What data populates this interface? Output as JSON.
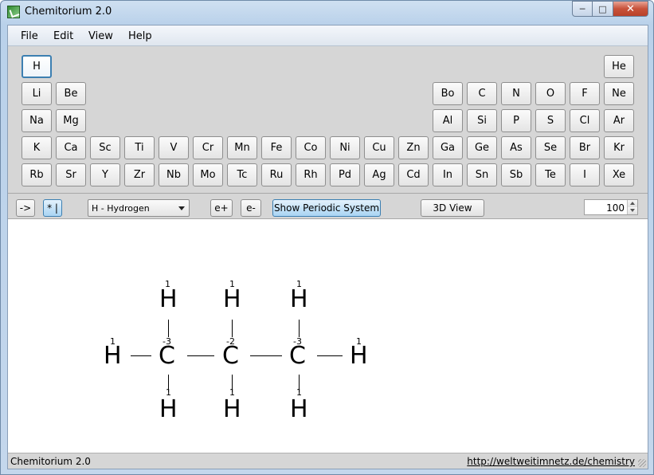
{
  "window": {
    "title": "Chemitorium 2.0"
  },
  "menu": {
    "file": "File",
    "edit": "Edit",
    "view": "View",
    "help": "Help"
  },
  "elements": {
    "H": "H",
    "He": "He",
    "Li": "Li",
    "Be": "Be",
    "Bo": "Bo",
    "C": "C",
    "N": "N",
    "O": "O",
    "F": "F",
    "Ne": "Ne",
    "Na": "Na",
    "Mg": "Mg",
    "Al": "Al",
    "Si": "Si",
    "P": "P",
    "S": "S",
    "Cl": "Cl",
    "Ar": "Ar",
    "K": "K",
    "Ca": "Ca",
    "Sc": "Sc",
    "Ti": "Ti",
    "V": "V",
    "Cr": "Cr",
    "Mn": "Mn",
    "Fe": "Fe",
    "Co": "Co",
    "Ni": "Ni",
    "Cu": "Cu",
    "Zn": "Zn",
    "Ga": "Ga",
    "Ge": "Ge",
    "As": "As",
    "Se": "Se",
    "Br": "Br",
    "Kr": "Kr",
    "Rb": "Rb",
    "Sr": "Sr",
    "Y": "Y",
    "Zr": "Zr",
    "Nb": "Nb",
    "Mo": "Mo",
    "Tc": "Tc",
    "Ru": "Ru",
    "Rh": "Rh",
    "Pd": "Pd",
    "Ag": "Ag",
    "Cd": "Cd",
    "In": "In",
    "Sn": "Sn",
    "Sb": "Sb",
    "Te": "Te",
    "I": "I",
    "Xe": "Xe"
  },
  "toolbar": {
    "arrow_label": "->",
    "mode_label": "* |",
    "element_select": "H - Hydrogen",
    "e_plus": "e+",
    "e_minus": "e-",
    "show_periodic": "Show Periodic System",
    "view_3d": "3D View",
    "zoom": "100"
  },
  "molecule": {
    "h_top_1": "H",
    "h_top_2": "H",
    "h_top_3": "H",
    "h_left": "H",
    "c1": "C",
    "c2": "C",
    "c3": "C",
    "h_right": "H",
    "h_bot_1": "H",
    "h_bot_2": "H",
    "h_bot_3": "H",
    "n_top_1": "1",
    "n_top_2": "1",
    "n_top_3": "1",
    "n_left": "1",
    "n_right": "1",
    "n_bot_1": "1",
    "n_bot_2": "1",
    "n_bot_3": "1",
    "ox_c1": "-3",
    "ox_c2": "-2",
    "ox_c3": "-3"
  },
  "status": {
    "app_name": "Chemitorium 2.0",
    "link": "http://weltweitimnetz.de/chemistry"
  }
}
